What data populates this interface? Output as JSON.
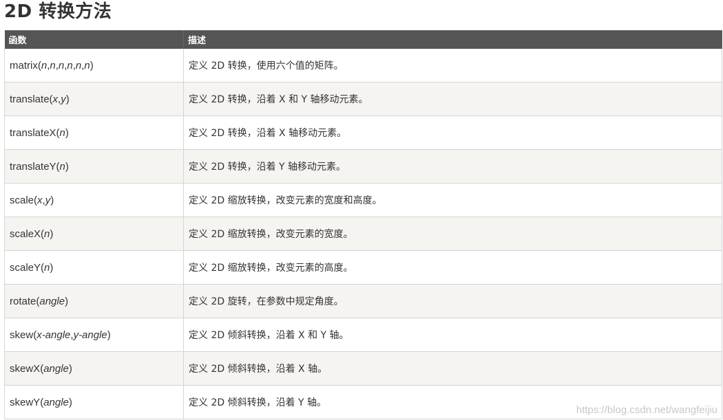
{
  "title": "2D 转换方法",
  "table": {
    "headers": [
      "函数",
      "描述"
    ],
    "rows": [
      {
        "fn": "matrix",
        "params": [
          "n",
          "n",
          "n",
          "n",
          "n",
          "n"
        ],
        "desc": "定义 2D 转换，使用六个值的矩阵。"
      },
      {
        "fn": "translate",
        "params": [
          "x",
          "y"
        ],
        "desc": "定义 2D 转换，沿着 X 和 Y 轴移动元素。"
      },
      {
        "fn": "translateX",
        "params": [
          "n"
        ],
        "desc": "定义 2D 转换，沿着 X 轴移动元素。"
      },
      {
        "fn": "translateY",
        "params": [
          "n"
        ],
        "desc": "定义 2D 转换，沿着 Y 轴移动元素。"
      },
      {
        "fn": "scale",
        "params": [
          "x",
          "y"
        ],
        "desc": "定义 2D 缩放转换，改变元素的宽度和高度。"
      },
      {
        "fn": "scaleX",
        "params": [
          "n"
        ],
        "desc": "定义 2D 缩放转换，改变元素的宽度。"
      },
      {
        "fn": "scaleY",
        "params": [
          "n"
        ],
        "desc": "定义 2D 缩放转换，改变元素的高度。"
      },
      {
        "fn": "rotate",
        "params": [
          "angle"
        ],
        "desc": "定义 2D 旋转，在参数中规定角度。"
      },
      {
        "fn": "skew",
        "params": [
          "x-angle",
          "y-angle"
        ],
        "desc": "定义 2D 倾斜转换，沿着 X 和 Y 轴。"
      },
      {
        "fn": "skewX",
        "params": [
          "angle"
        ],
        "desc": "定义 2D 倾斜转换，沿着 X 轴。"
      },
      {
        "fn": "skewY",
        "params": [
          "angle"
        ],
        "desc": "定义 2D 倾斜转换，沿着 Y 轴。"
      }
    ]
  },
  "watermark": "https://blog.csdn.net/wangfeijiu"
}
